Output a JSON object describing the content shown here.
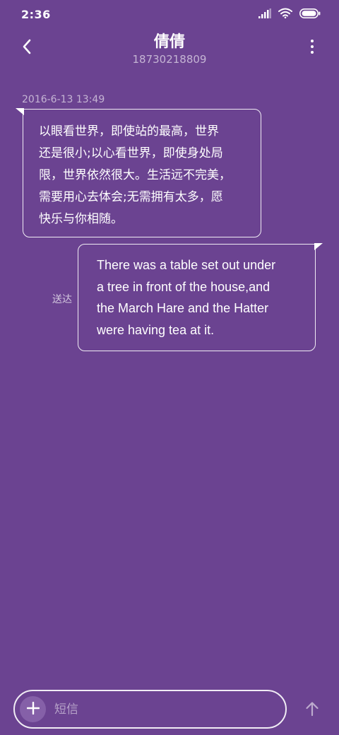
{
  "status_bar": {
    "time": "2:36",
    "icons": [
      "signal-icon",
      "wifi-icon",
      "battery-icon"
    ]
  },
  "header": {
    "contact_name": "倩倩",
    "contact_number": "18730218809",
    "back_icon": "chevron-left-icon",
    "more_icon": "more-vertical-icon"
  },
  "conversation": {
    "timestamp": "2016-6-13 13:49",
    "messages": [
      {
        "direction": "incoming",
        "lines": [
          "以眼看世界，即使站的最高，世界",
          "还是很小;以心看世界，即使身处局",
          "限，世界依然很大。生活远不完美，",
          "需要用心去体会;无需拥有太多，愿",
          "快乐与你相随。"
        ]
      },
      {
        "direction": "outgoing",
        "status": "送达",
        "lines": [
          "There was a table set out under",
          "a tree in front of the house,and",
          "the March Hare and the Hatter",
          "were having tea at it."
        ]
      }
    ]
  },
  "composer": {
    "placeholder": "短信",
    "value": "",
    "attach_icon": "plus-icon",
    "send_icon": "arrow-up-icon"
  },
  "colors": {
    "background": "#6b4391",
    "attach_button": "#8560a8",
    "text": "#ffffff"
  }
}
